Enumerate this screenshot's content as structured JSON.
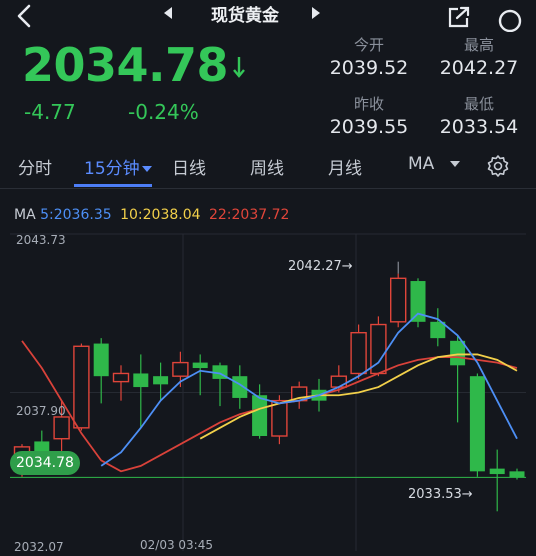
{
  "header": {
    "title": "现货黄金"
  },
  "quote": {
    "price": "2034.78",
    "change": "-4.77",
    "change_pct": "-0.24%",
    "open_label": "今开",
    "open": "2039.52",
    "high_label": "最高",
    "high": "2042.27",
    "prev_close_label": "昨收",
    "prev_close": "2039.55",
    "low_label": "最低",
    "low": "2033.54"
  },
  "tabs": [
    {
      "label": "分时"
    },
    {
      "label": "15分钟"
    },
    {
      "label": "日线"
    },
    {
      "label": "周线"
    },
    {
      "label": "月线"
    },
    {
      "label": "MA"
    }
  ],
  "colors": {
    "up": "#e0453a",
    "down": "#2fb84a",
    "accent": "#4d7ef7",
    "ma5": "#4d8ff5",
    "ma10": "#f2d04a",
    "ma22": "#d9423a"
  },
  "chart_data": {
    "type": "candlestick",
    "ma_legend": {
      "label": "MA",
      "ma5": "5:2036.35",
      "ma10": "10:2038.04",
      "ma22": "22:2037.72"
    },
    "ylim": [
      2032.07,
      2043.73
    ],
    "y_top_label": "2043.73",
    "y_bottom_label": "2032.07",
    "mid_label": "2037.90",
    "current_price_label": "2034.78",
    "x_label": "02/03 03:45",
    "high_annotation": "2042.27",
    "low_annotation": "2033.53",
    "candles": [
      {
        "o": 2035.0,
        "c": 2035.9,
        "h": 2036.0,
        "l": 2034.8
      },
      {
        "o": 2036.1,
        "c": 2035.3,
        "h": 2036.5,
        "l": 2035.0
      },
      {
        "o": 2036.2,
        "c": 2037.0,
        "h": 2037.6,
        "l": 2035.7
      },
      {
        "o": 2036.6,
        "c": 2039.6,
        "h": 2039.7,
        "l": 2036.5
      },
      {
        "o": 2039.7,
        "c": 2038.5,
        "h": 2039.9,
        "l": 2037.5
      },
      {
        "o": 2038.3,
        "c": 2038.6,
        "h": 2038.9,
        "l": 2037.6
      },
      {
        "o": 2038.6,
        "c": 2038.1,
        "h": 2039.3,
        "l": 2036.6
      },
      {
        "o": 2038.5,
        "c": 2038.2,
        "h": 2039.0,
        "l": 2037.6
      },
      {
        "o": 2038.5,
        "c": 2039.0,
        "h": 2039.4,
        "l": 2038.1
      },
      {
        "o": 2039.0,
        "c": 2038.8,
        "h": 2039.3,
        "l": 2037.8
      },
      {
        "o": 2038.9,
        "c": 2038.4,
        "h": 2039.0,
        "l": 2037.4
      },
      {
        "o": 2038.5,
        "c": 2037.7,
        "h": 2038.9,
        "l": 2037.3
      },
      {
        "o": 2037.8,
        "c": 2036.3,
        "h": 2038.2,
        "l": 2036.2
      },
      {
        "o": 2036.3,
        "c": 2037.6,
        "h": 2037.8,
        "l": 2036.0
      },
      {
        "o": 2037.6,
        "c": 2038.1,
        "h": 2038.3,
        "l": 2037.3
      },
      {
        "o": 2038.0,
        "c": 2037.6,
        "h": 2038.4,
        "l": 2037.2
      },
      {
        "o": 2038.1,
        "c": 2038.5,
        "h": 2038.9,
        "l": 2037.9
      },
      {
        "o": 2038.6,
        "c": 2040.1,
        "h": 2040.4,
        "l": 2038.4
      },
      {
        "o": 2038.6,
        "c": 2040.4,
        "h": 2040.7,
        "l": 2038.5
      },
      {
        "o": 2040.5,
        "c": 2042.1,
        "h": 2042.27,
        "l": 2040.3
      },
      {
        "o": 2042.0,
        "c": 2040.5,
        "h": 2042.1,
        "l": 2040.3
      },
      {
        "o": 2040.5,
        "c": 2039.9,
        "h": 2041.0,
        "l": 2039.6
      },
      {
        "o": 2039.8,
        "c": 2038.9,
        "h": 2040.0,
        "l": 2036.8
      },
      {
        "o": 2038.5,
        "c": 2035.0,
        "h": 2038.6,
        "l": 2034.8
      },
      {
        "o": 2035.1,
        "c": 2034.9,
        "h": 2035.8,
        "l": 2033.53
      },
      {
        "o": 2035.0,
        "c": 2034.78,
        "h": 2035.1,
        "l": 2034.7
      }
    ],
    "ma5": [
      null,
      null,
      null,
      null,
      2035.2,
      2035.7,
      2036.6,
      2037.6,
      2038.3,
      2038.7,
      2038.6,
      2038.2,
      2037.7,
      2037.5,
      2037.6,
      2037.8,
      2038.1,
      2038.5,
      2039.0,
      2040.1,
      2040.8,
      2040.6,
      2040.0,
      2039.0,
      2037.6,
      2036.2
    ],
    "ma10": [
      null,
      null,
      null,
      null,
      null,
      null,
      null,
      null,
      null,
      2036.2,
      2036.6,
      2037.0,
      2037.3,
      2037.5,
      2037.7,
      2037.8,
      2037.8,
      2037.9,
      2038.1,
      2038.5,
      2038.9,
      2039.2,
      2039.3,
      2039.3,
      2039.1,
      2038.7
    ],
    "ma22": [
      2039.8,
      2038.8,
      2037.6,
      2036.4,
      2035.4,
      2035.0,
      2035.2,
      2035.6,
      2036.0,
      2036.4,
      2036.8,
      2037.1,
      2037.3,
      2037.5,
      2037.6,
      2037.8,
      2038.0,
      2038.3,
      2038.6,
      2038.9,
      2039.1,
      2039.2,
      2039.2,
      2039.1,
      2039.0,
      2038.8
    ]
  }
}
